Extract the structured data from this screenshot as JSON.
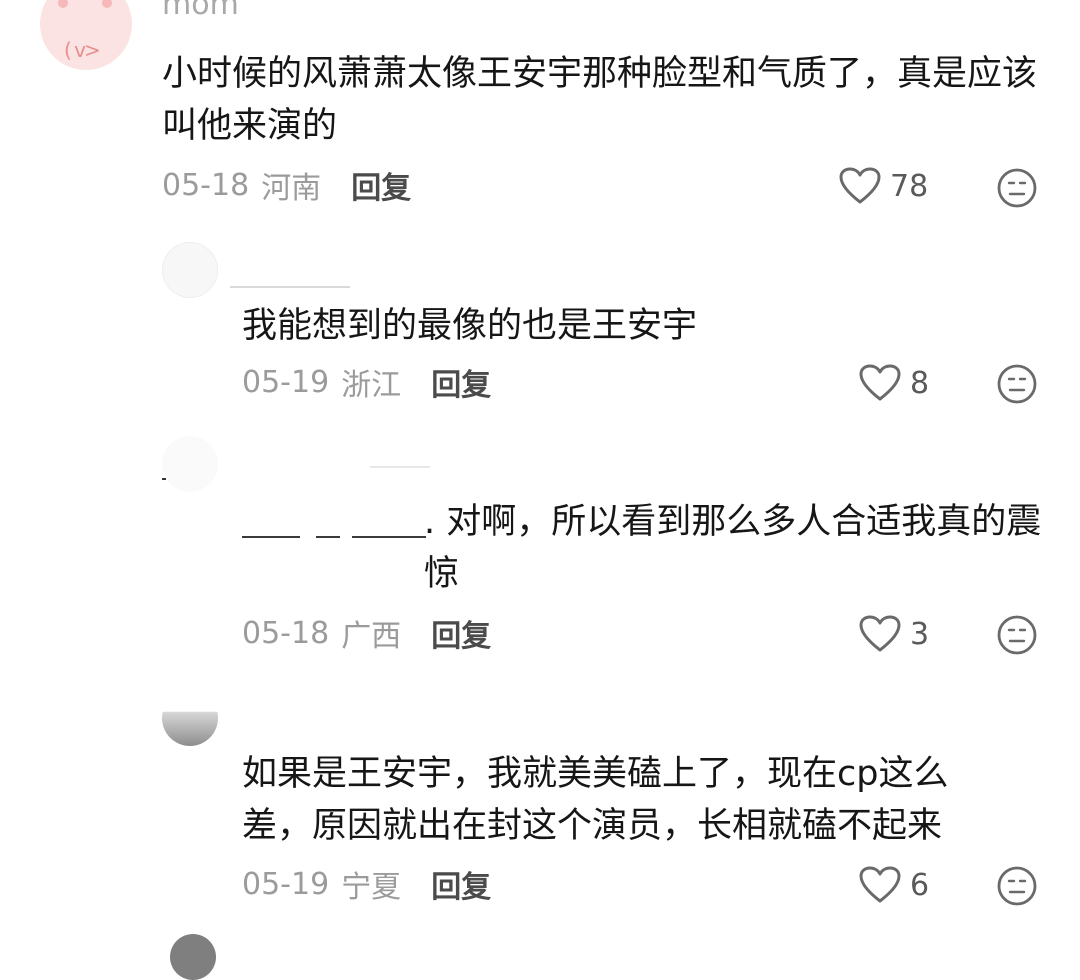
{
  "comments": [
    {
      "username": "mom",
      "text": "小时候的风萧萧太像王安宇那种脸型和气质了，真是应该叫他来演的",
      "date": "05-18",
      "location": "河南",
      "reply": "回复",
      "likes": "78"
    },
    {
      "text": "我能想到的最像的也是王安宇",
      "date": "05-19",
      "location": "浙江",
      "reply": "回复",
      "likes": "8"
    },
    {
      "text": ". 对啊，所以看到那么多人合适我真的震惊",
      "date": "05-18",
      "location": "广西",
      "reply": "回复",
      "likes": "3"
    },
    {
      "text": "如果是王安宇，我就美美磕上了，现在cp这么差，原因就出在封这个演员，长相就磕不起来",
      "date": "05-19",
      "location": "宁夏",
      "reply": "回复",
      "likes": "6"
    }
  ],
  "icons": {
    "heart": "heart-outline",
    "reaction": "neutral-face"
  },
  "colors": {
    "text": "#161616",
    "meta": "#9b9b9b",
    "reply": "#4b4b4b",
    "icon": "#6a6a6a"
  }
}
